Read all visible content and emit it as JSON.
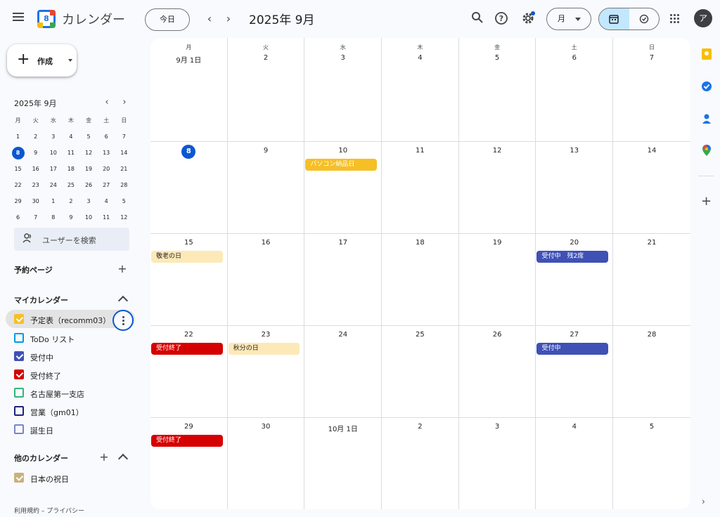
{
  "header": {
    "app_title": "カレンダー",
    "logo_day": "8",
    "today_label": "今日",
    "prev": "‹",
    "next": "›",
    "month_title": "2025年 9月",
    "view_label": "月",
    "avatar_letter": "ア"
  },
  "sidebar": {
    "create_label": "作成",
    "mini_title": "2025年 9月",
    "mini_weekdays": [
      "月",
      "火",
      "水",
      "木",
      "金",
      "土",
      "日"
    ],
    "mini_weeks": [
      [
        "1",
        "2",
        "3",
        "4",
        "5",
        "6",
        "7"
      ],
      [
        "8",
        "9",
        "10",
        "11",
        "12",
        "13",
        "14"
      ],
      [
        "15",
        "16",
        "17",
        "18",
        "19",
        "20",
        "21"
      ],
      [
        "22",
        "23",
        "24",
        "25",
        "26",
        "27",
        "28"
      ],
      [
        "29",
        "30",
        "1",
        "2",
        "3",
        "4",
        "5"
      ],
      [
        "6",
        "7",
        "8",
        "9",
        "10",
        "11",
        "12"
      ]
    ],
    "search_people": "ユーザーを検索",
    "booking_pages": "予約ページ",
    "my_calendars": "マイカレンダー",
    "other_calendars": "他のカレンダー",
    "calendars": [
      {
        "name": "予定表（recomm03）",
        "color": "#f6bf26",
        "checked": true
      },
      {
        "name": "ToDo リスト",
        "color": "#039be5",
        "checked": false
      },
      {
        "name": "受付中",
        "color": "#3f51b5",
        "checked": true
      },
      {
        "name": "受付終了",
        "color": "#d50000",
        "checked": true
      },
      {
        "name": "名古屋第一支店",
        "color": "#33b679",
        "checked": false
      },
      {
        "name": "営業（gm01）",
        "color": "#3f51b5",
        "checked": false
      },
      {
        "name": "誕生日",
        "color": "#7986cb",
        "checked": false
      }
    ],
    "other": [
      {
        "name": "日本の祝日",
        "color": "#c9b27c",
        "checked": true
      }
    ],
    "footer": "利用規約 – プライバシー"
  },
  "calendar": {
    "weekdays": [
      "月",
      "火",
      "水",
      "木",
      "金",
      "土",
      "日"
    ],
    "weeks": [
      [
        "9月 1日",
        "2",
        "3",
        "4",
        "5",
        "6",
        "7"
      ],
      [
        "8",
        "9",
        "10",
        "11",
        "12",
        "13",
        "14"
      ],
      [
        "15",
        "16",
        "17",
        "18",
        "19",
        "20",
        "21"
      ],
      [
        "22",
        "23",
        "24",
        "25",
        "26",
        "27",
        "28"
      ],
      [
        "29",
        "30",
        "10月 1日",
        "2",
        "3",
        "4",
        "5"
      ]
    ],
    "events": {
      "pc_delivery": "パソコン納品日",
      "keiro": "敬老の日",
      "accepting_2": "受付中　残2席",
      "closed_22": "受付終了",
      "shubun": "秋分の日",
      "accepting_27": "受付中",
      "closed_29": "受付終了"
    }
  }
}
